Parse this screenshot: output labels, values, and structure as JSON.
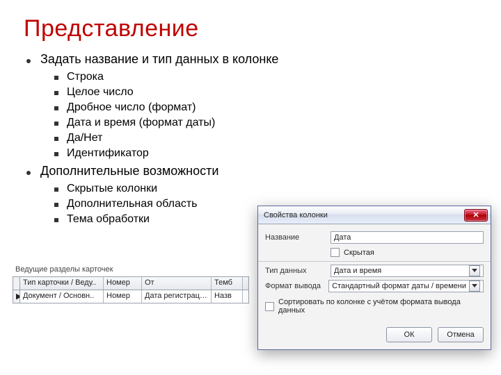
{
  "slide": {
    "title": "Представление",
    "bullet1": "Задать название и тип данных в колонке",
    "sub1": [
      "Строка",
      "Целое число",
      "Дробное число (формат)",
      "Дата и время (формат даты)",
      "Да/Нет",
      "Идентификатор"
    ],
    "bullet2": "Дополнительные возможности",
    "sub2": [
      "Скрытые колонки",
      "Дополнительная область",
      "Тема обработки"
    ]
  },
  "bgApp": {
    "sectionLabel": "Ведущие разделы карточек",
    "headers": {
      "c1": "Тип карточки / Веду..",
      "c2": "Номер",
      "c3": "От",
      "c4": "Темб"
    },
    "row": {
      "c1": "Документ / Основн..",
      "c2": "Номер",
      "c3": "Дата регистрации",
      "c4": "Назв"
    }
  },
  "dialog": {
    "title": "Свойства колонки",
    "name_label": "Название",
    "name_value": "Дата",
    "hidden_label": "Скрытая",
    "type_label": "Тип данных",
    "type_value": "Дата и время",
    "format_label": "Формат вывода",
    "format_value": "Стандартный формат даты / времени",
    "sort_label": "Сортировать по колонке с учётом формата вывода данных",
    "ok": "ОК",
    "cancel": "Отмена"
  }
}
